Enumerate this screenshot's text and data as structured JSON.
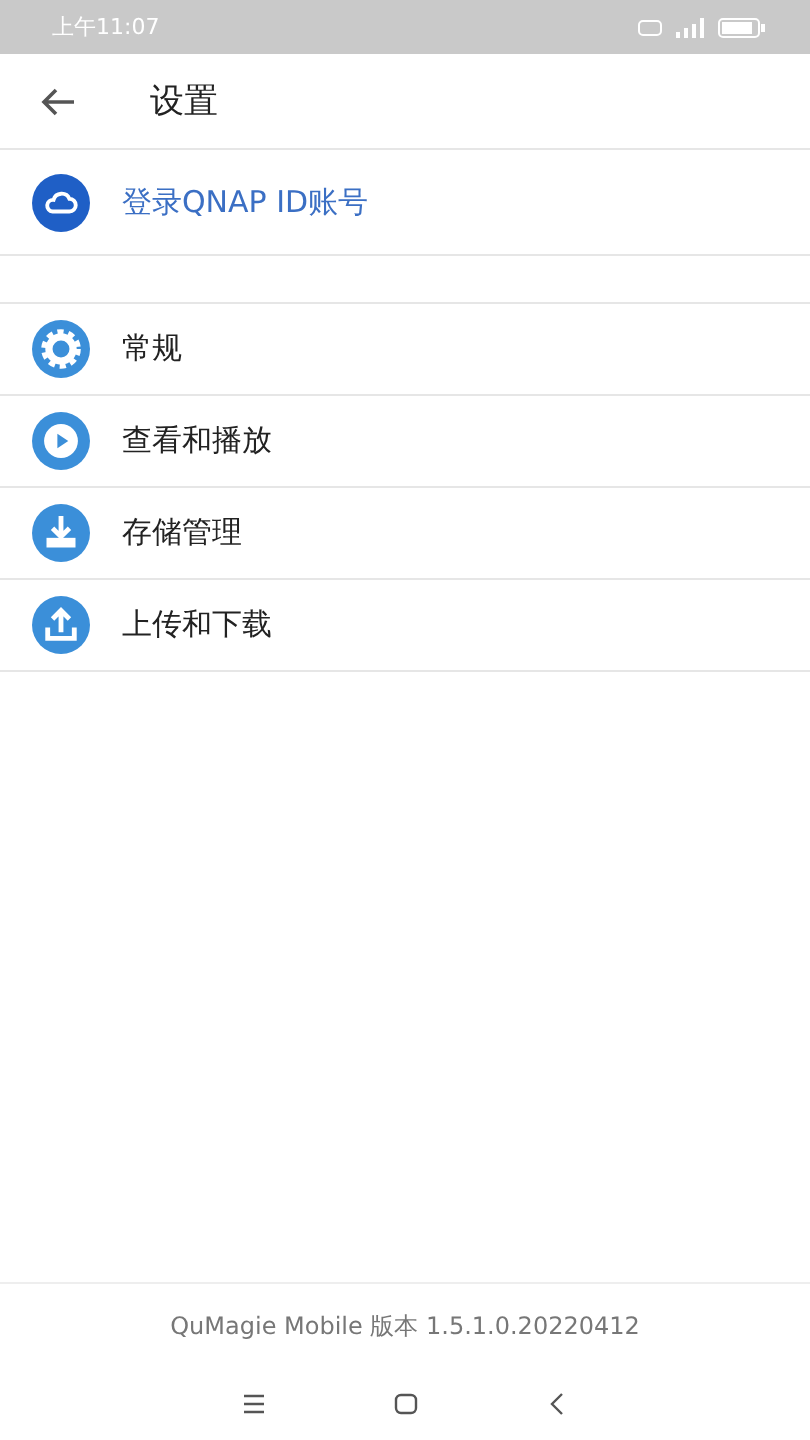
{
  "status_bar": {
    "time": "上午11:07"
  },
  "header": {
    "title": "设置"
  },
  "account": {
    "label": "登录QNAP ID账号"
  },
  "settings": [
    {
      "kind": "gear",
      "label": "常规"
    },
    {
      "kind": "play",
      "label": "查看和播放"
    },
    {
      "kind": "download",
      "label": "存储管理"
    },
    {
      "kind": "upload",
      "label": "上传和下载"
    }
  ],
  "footer": {
    "version": "QuMagie Mobile 版本 1.5.1.0.20220412"
  }
}
